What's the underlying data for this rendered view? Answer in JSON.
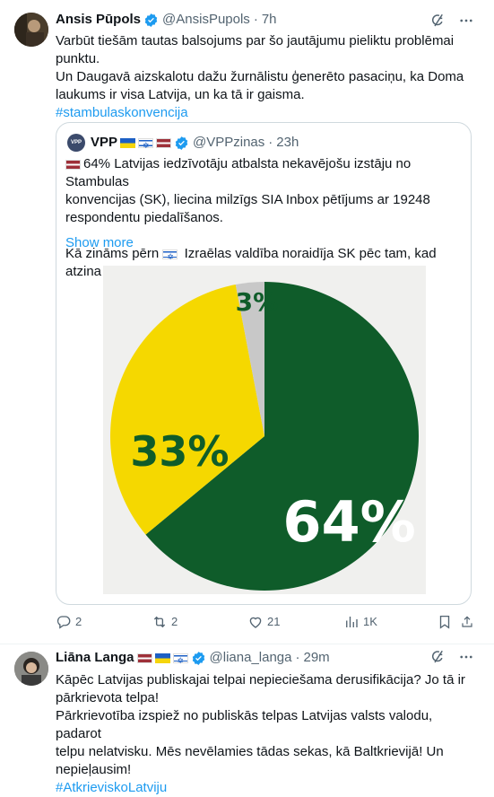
{
  "tweet1": {
    "author_name": "Ansis Pūpols",
    "handle": "@AnsisPupols",
    "separator": "·",
    "time": "7h",
    "lines": [
      "Varbūt tiešām tautas balsojums par šo jautājumu pieliktu problēmai",
      "punktu.",
      "Un Daugavā aizskalotu dažu žurnālistu ģenerēto pasaciņu, ka Doma",
      "laukums ir visa Latvija, un ka tā ir gaisma."
    ],
    "hashtag": "#stambulaskonvencija"
  },
  "quote": {
    "avatar_text": "VPP",
    "author_name": "VPP",
    "handle": "@VPPzinas",
    "separator": "·",
    "time": "23h",
    "lines": [
      "64% Latvijas iedzīvotāju atbalsta nekavējošu izstāju no Stambulas",
      "konvencijas (SK), liecina milzīgs SIA Inbox pētījums ar 19248",
      "respondentu piedalīšanos."
    ],
    "line2_before": "Kā zināms pērn",
    "line2_after": "Izraēlas valdība noraidīja SK pēc tam, kad atzina ...",
    "show_more": "Show more"
  },
  "chart_data": {
    "type": "pie",
    "labels": [
      "64%",
      "33%",
      "3%"
    ],
    "values": [
      64,
      33,
      3
    ],
    "colors": [
      "#0f5c2a",
      "#f5d800",
      "#c8c8c8"
    ],
    "label_colors": [
      "#ffffff",
      "#0f5c2a",
      "#0f5c2a"
    ],
    "background": "#f0f0ee"
  },
  "actions": {
    "replies": "2",
    "reposts": "2",
    "likes": "21",
    "views": "1K"
  },
  "tweet2": {
    "author_name": "Liāna Langa",
    "handle": "@liana_langa",
    "separator": "·",
    "time": "29m",
    "lines": [
      "Kāpēc Latvijas publiskajai telpai nepieciešama derusifikācija?  Jo tā ir",
      "pārkrievota telpa!",
      "Pārkrievotība izspiež no publiskās telpas Latvijas valsts valodu, padarot",
      "telpu nelatvisku. Mēs nevēlamies tādas sekas, kā Baltkrievijā!  Un",
      "nepieļausim!"
    ],
    "hashtag": "#AtkrieviskoLatviju"
  },
  "icons": [
    "verified-badge-icon",
    "grok-icon",
    "more-icon",
    "reply-icon",
    "repost-icon",
    "like-icon",
    "views-icon",
    "bookmark-icon",
    "share-icon"
  ],
  "colors": {
    "accent": "#1d9bf0",
    "muted": "#536471",
    "border": "#cfd9de"
  }
}
